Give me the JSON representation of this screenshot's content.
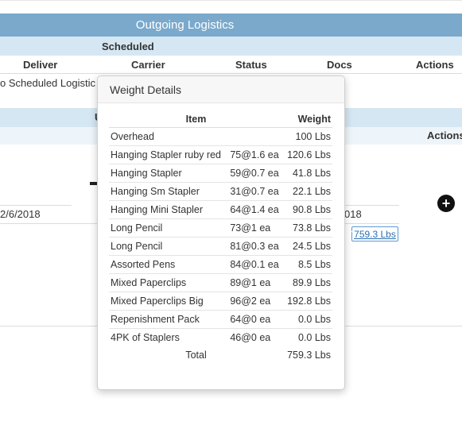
{
  "header": {
    "title": "Outgoing Logistics",
    "scheduled": "Scheduled"
  },
  "columns": [
    "Deliver",
    "Carrier",
    "Status",
    "Docs",
    "Actions"
  ],
  "empty_message": "o Scheduled Logistic",
  "second_section": {
    "letter": "U",
    "actions_label": "Actions",
    "date_left": "2/6/2018",
    "date_right": "018",
    "weight_link": "759.3 Lbs",
    "add_symbol": "+"
  },
  "popover": {
    "title": "Weight Details",
    "headers": {
      "item": "Item",
      "weight": "Weight"
    },
    "rows": [
      {
        "item": "Overhead",
        "qty": "",
        "weight": "100 Lbs"
      },
      {
        "item": "Hanging Stapler ruby red",
        "qty": "75@1.6 ea",
        "weight": "120.6 Lbs"
      },
      {
        "item": "Hanging Stapler",
        "qty": "59@0.7 ea",
        "weight": "41.8 Lbs"
      },
      {
        "item": "Hanging Sm Stapler",
        "qty": "31@0.7 ea",
        "weight": "22.1 Lbs"
      },
      {
        "item": "Hanging Mini Stapler",
        "qty": "64@1.4 ea",
        "weight": "90.8 Lbs"
      },
      {
        "item": "Long Pencil",
        "qty": "73@1 ea",
        "weight": "73.8 Lbs"
      },
      {
        "item": "Long Pencil",
        "qty": "81@0.3 ea",
        "weight": "24.5 Lbs"
      },
      {
        "item": "Assorted Pens",
        "qty": "84@0.1 ea",
        "weight": "8.5 Lbs"
      },
      {
        "item": "Mixed Paperclips",
        "qty": "89@1 ea",
        "weight": "89.9 Lbs"
      },
      {
        "item": "Mixed Paperclips Big",
        "qty": "96@2 ea",
        "weight": "192.8 Lbs"
      },
      {
        "item": "Repenishment Pack",
        "qty": "64@0 ea",
        "weight": "0.0 Lbs"
      },
      {
        "item": "4PK of Staplers",
        "qty": "46@0 ea",
        "weight": "0.0 Lbs"
      }
    ],
    "total_label": "Total",
    "total_weight": "759.3 Lbs"
  }
}
